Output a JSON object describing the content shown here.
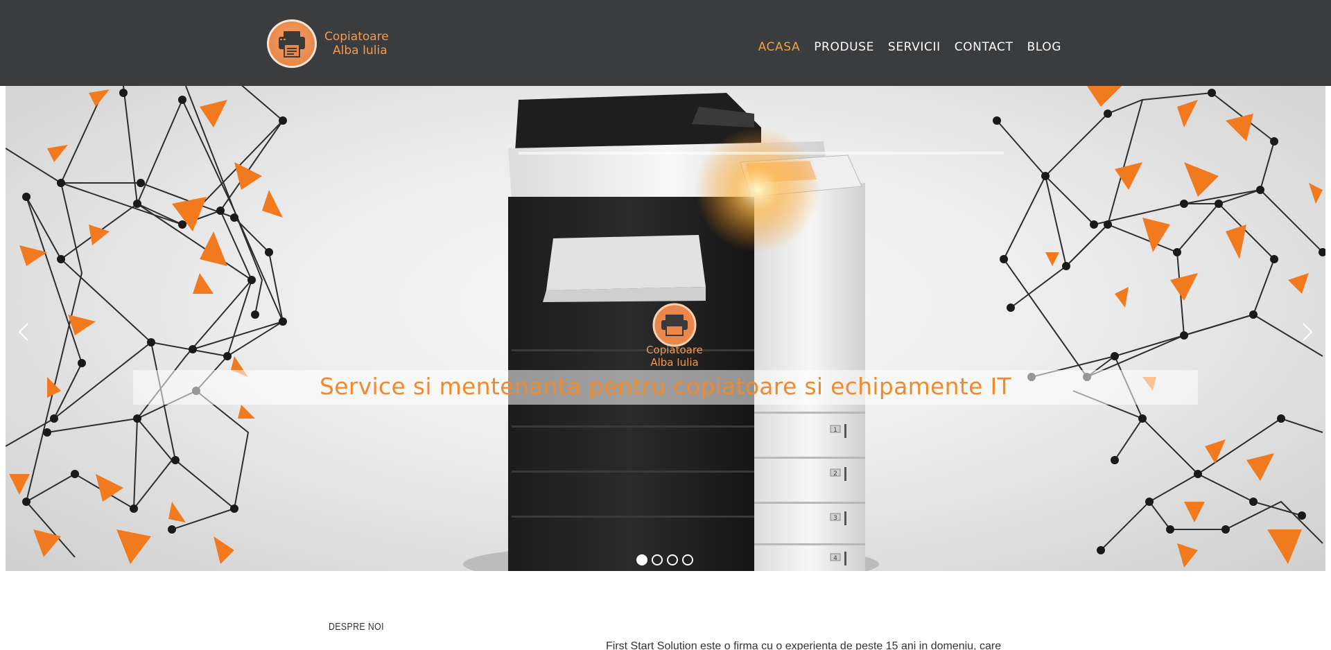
{
  "header": {
    "logo": {
      "line1": "Copiatoare",
      "line2": "Alba Iulia"
    },
    "nav": [
      {
        "label": "ACASA",
        "active": true
      },
      {
        "label": "PRODUSE",
        "active": false
      },
      {
        "label": "SERVICII",
        "active": false
      },
      {
        "label": "CONTACT",
        "active": false
      },
      {
        "label": "BLOG",
        "active": false
      }
    ]
  },
  "slider": {
    "caption": "Service si mentenanta pentru copiatoare si echipamente IT",
    "product_logo": {
      "line1": "Copiatoare",
      "line2": "Alba Iulia"
    },
    "tray_numbers": [
      "1",
      "2",
      "3",
      "4"
    ],
    "slide_count": 4,
    "active_slide": 1,
    "prev_icon": "chevron-left-icon",
    "next_icon": "chevron-right-icon"
  },
  "about": {
    "label": "DESPRE NOI",
    "text_line1": "First Start Solution este o firma cu o experienta de peste 15 ani in domeniu, care"
  },
  "colors": {
    "header_bg": "#3b3c3e",
    "accent": "#f3a23c",
    "caption": "#f08a2c",
    "network_orange": "#f27a1e"
  }
}
